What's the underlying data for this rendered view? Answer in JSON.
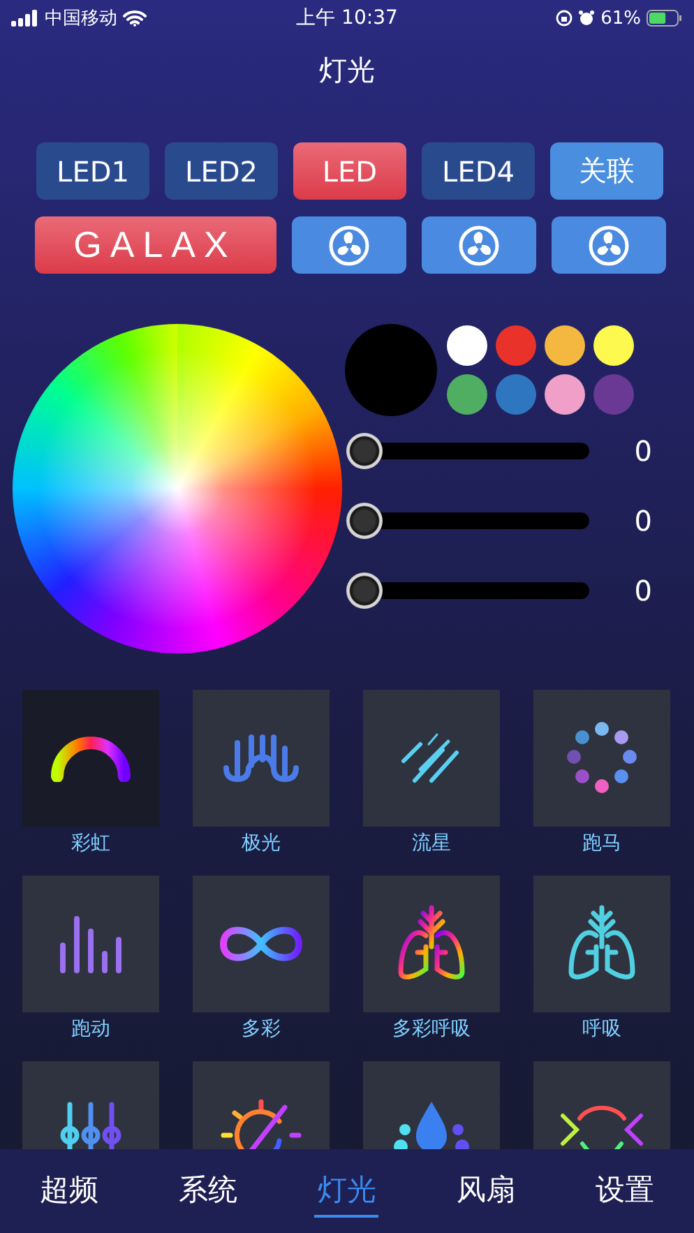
{
  "status_bar": {
    "carrier": "中国移动",
    "time": "上午 10:37",
    "battery": "61%"
  },
  "title": "灯光",
  "zones": [
    {
      "label": "LED1",
      "kind": "zone",
      "selected": false
    },
    {
      "label": "LED2",
      "kind": "zone",
      "selected": false
    },
    {
      "label": "LED",
      "kind": "zone",
      "selected": true
    },
    {
      "label": "LED4",
      "kind": "zone",
      "selected": false
    },
    {
      "label": "关联",
      "kind": "link",
      "selected": false
    }
  ],
  "devices": [
    {
      "kind": "logo",
      "label": "GALAX",
      "selected": true
    },
    {
      "kind": "fan",
      "selected": false
    },
    {
      "kind": "fan",
      "selected": false
    },
    {
      "kind": "fan",
      "selected": false
    }
  ],
  "swatches": [
    {
      "color": "#ffffff"
    },
    {
      "color": "#e8322a"
    },
    {
      "color": "#f4b740"
    },
    {
      "color": "#fdf94e"
    },
    {
      "color": "#4fae62"
    },
    {
      "color": "#2f76c0"
    },
    {
      "color": "#f0a0c8"
    },
    {
      "color": "#6a3994"
    }
  ],
  "sliders": [
    {
      "level": 0,
      "reading": "0"
    },
    {
      "level": 0,
      "reading": "0"
    },
    {
      "level": 0,
      "reading": "0"
    }
  ],
  "effects": [
    {
      "kind": "rainbow",
      "label": "彩虹",
      "selected": true
    },
    {
      "kind": "aurora",
      "label": "极光",
      "selected": false
    },
    {
      "kind": "meteor",
      "label": "流星",
      "selected": false
    },
    {
      "kind": "marquee",
      "label": "跑马",
      "selected": false
    },
    {
      "kind": "bars",
      "label": "跑动",
      "selected": false
    },
    {
      "kind": "infinity",
      "label": "多彩",
      "selected": false
    },
    {
      "kind": "lungs-color",
      "label": "多彩呼吸",
      "selected": false
    },
    {
      "kind": "lungs",
      "label": "呼吸",
      "selected": false
    },
    {
      "kind": "equalizer",
      "selected": false
    },
    {
      "kind": "sun",
      "selected": false
    },
    {
      "kind": "drop",
      "selected": false
    },
    {
      "kind": "arrows",
      "selected": false
    }
  ],
  "tabs": [
    {
      "label": "超频",
      "selected": false
    },
    {
      "label": "系统",
      "selected": false
    },
    {
      "label": "灯光",
      "selected": true
    },
    {
      "label": "风扇",
      "selected": false
    },
    {
      "label": "设置",
      "selected": false
    }
  ]
}
